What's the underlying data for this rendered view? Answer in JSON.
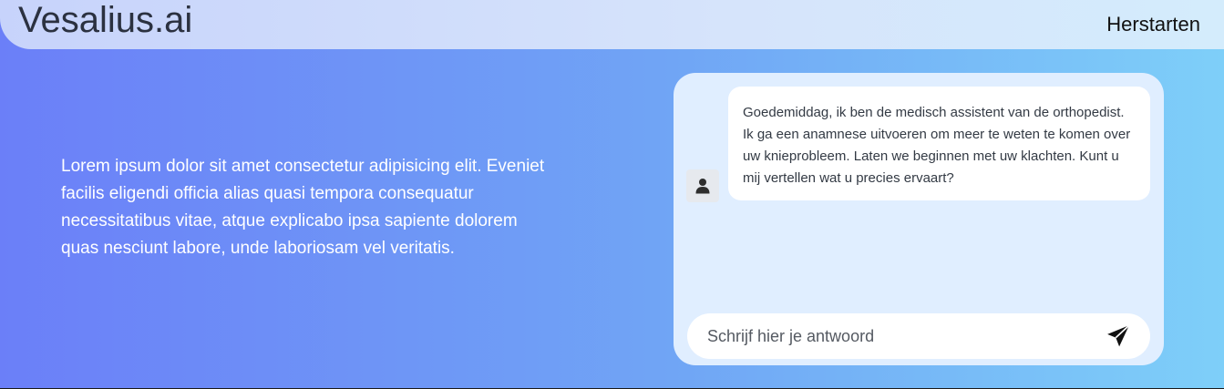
{
  "header": {
    "brand": "Vesalius.ai",
    "restart_label": "Herstarten"
  },
  "intro": {
    "text": "Lorem ipsum dolor sit amet consectetur adipisicing elit. Eveniet facilis eligendi officia alias quasi tempora consequatur necessitatibus vitae, atque explicabo ipsa sapiente dolorem quas nesciunt labore, unde laboriosam vel veritatis."
  },
  "chat": {
    "messages": [
      {
        "sender_icon": "user-icon",
        "text": "Goedemiddag, ik ben de medisch assistent van de orthopedist. Ik ga een anamnese uitvoeren om meer te weten te komen over uw knieprobleem. Laten we beginnen met uw klachten. Kunt u mij vertellen wat u precies ervaart?"
      }
    ],
    "input": {
      "value": "",
      "placeholder": "Schrijf hier je antwoord"
    },
    "send_icon": "send-icon"
  },
  "colors": {
    "gradient_start": "#6b7ff8",
    "gradient_end": "#7ecff9",
    "chat_panel": "#e0eeff"
  }
}
